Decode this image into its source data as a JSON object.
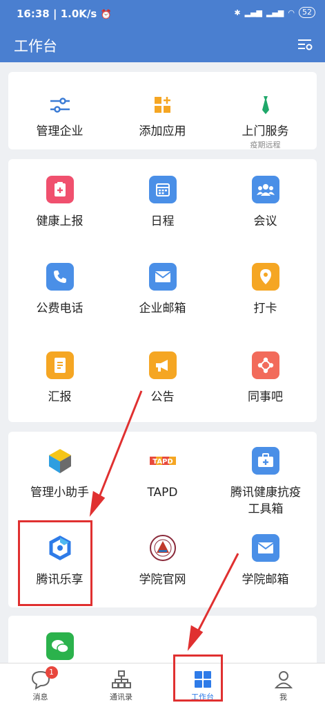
{
  "status_bar": {
    "time": "16:38",
    "speed": "1.0K/s",
    "battery": "52"
  },
  "header": {
    "title": "工作台"
  },
  "group1": [
    {
      "label": "管理企业",
      "icon": "sliders-icon"
    },
    {
      "label": "添加应用",
      "icon": "add-app-icon"
    },
    {
      "label": "上门服务",
      "sub": "疫期远程",
      "icon": "tie-icon"
    }
  ],
  "group2": [
    {
      "label": "健康上报",
      "icon": "health-report-icon",
      "color": "#f0506e"
    },
    {
      "label": "日程",
      "icon": "calendar-icon",
      "color": "#4a8fe7"
    },
    {
      "label": "会议",
      "icon": "meeting-icon",
      "color": "#4a8fe7"
    },
    {
      "label": "公费电话",
      "icon": "phone-icon",
      "color": "#4a8fe7"
    },
    {
      "label": "企业邮箱",
      "icon": "mail-icon",
      "color": "#4a8fe7"
    },
    {
      "label": "打卡",
      "icon": "location-pin-icon",
      "color": "#f5a623"
    },
    {
      "label": "汇报",
      "icon": "report-icon",
      "color": "#f5a623"
    },
    {
      "label": "公告",
      "icon": "megaphone-icon",
      "color": "#f5a623"
    },
    {
      "label": "同事吧",
      "icon": "share-icon",
      "color": "#f26b5b"
    }
  ],
  "group3": [
    {
      "label": "管理小助手",
      "icon": "assistant-icon"
    },
    {
      "label": "TAPD",
      "icon": "tapd-logo-icon"
    },
    {
      "label": "腾讯健康抗疫工具箱",
      "icon": "medkit-icon",
      "color": "#4a8fe7"
    },
    {
      "label": "腾讯乐享",
      "icon": "lexiang-icon"
    },
    {
      "label": "学院官网",
      "icon": "college-emblem-icon"
    },
    {
      "label": "学院邮箱",
      "icon": "mail-icon",
      "color": "#4a8fe7"
    }
  ],
  "group4": [
    {
      "label": "",
      "icon": "wechat-icon",
      "color": "#2bb24c"
    }
  ],
  "tabs": [
    {
      "label": "消息",
      "icon": "chat-icon",
      "badge": "1"
    },
    {
      "label": "通讯录",
      "icon": "org-chart-icon"
    },
    {
      "label": "工作台",
      "icon": "grid-icon"
    },
    {
      "label": "我",
      "icon": "person-icon"
    }
  ],
  "colors": {
    "primary": "#4a7fd0",
    "annotation": "#e03030"
  }
}
